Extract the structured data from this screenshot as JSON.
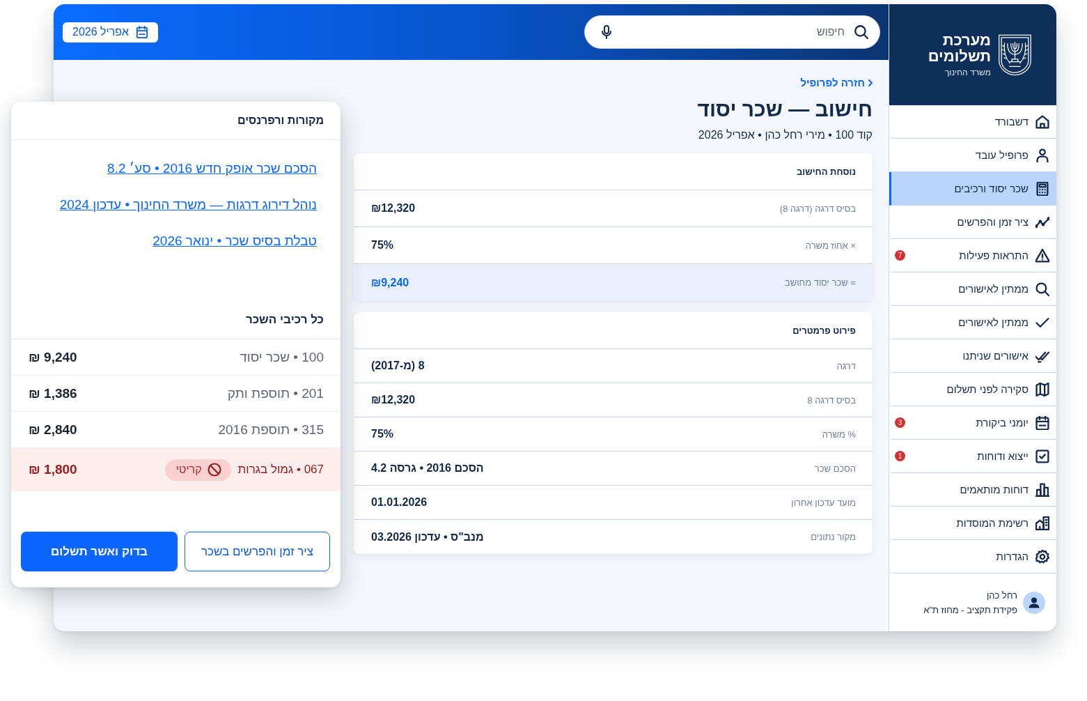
{
  "sidebar": {
    "title": "מערכת תשלומים",
    "subtitle": "משרד החינוך",
    "items": [
      {
        "label": "דשבורד",
        "selected": false
      },
      {
        "label": "פרופיל עובד",
        "selected": false
      },
      {
        "label": "שכר יסוד ורכיבים",
        "selected": true
      },
      {
        "label": "ציר זמן והפרשים",
        "selected": false
      },
      {
        "label": "התראות פעילות",
        "selected": false,
        "badge": "7"
      },
      {
        "label": "ממתין לאישורים",
        "selected": false
      },
      {
        "label": "ממתין לאישורים",
        "selected": false
      },
      {
        "label": "אישורים שניתנו",
        "selected": false
      },
      {
        "label": "סקירה לפני תשלום",
        "selected": false
      },
      {
        "label": "יומני ביקורת",
        "selected": false,
        "badge": "3"
      },
      {
        "label": "ייצוא ודוחות",
        "selected": false,
        "badge": "1"
      },
      {
        "label": "דוחות מותאמים",
        "selected": false
      },
      {
        "label": "רשימת המוסדות",
        "selected": false
      },
      {
        "label": "הגדרות",
        "selected": false
      }
    ],
    "user": {
      "name": "רחל כהן",
      "role": "פקידת תקציב - מחוז ת\"א"
    }
  },
  "top_bar": {
    "search": {
      "placeholder": "חיפוש"
    },
    "date_button": "אפריל 2026"
  },
  "page": {
    "back_link": "חזרה לפרופיל",
    "title": "חישוב — שכר יסוד",
    "subtitle": "קוד 100 • מירי רחל כהן • אפריל 2026"
  },
  "formula_card": {
    "title": "נוסחת החישוב",
    "rows": [
      {
        "label": "בסיס דרגה (דרגה 8)",
        "value": "₪12,320",
        "highlighted": false
      },
      {
        "label": "× אחוז משרה",
        "value": "75%",
        "highlighted": false
      },
      {
        "label": "= שכר יסוד מחושב",
        "value": "₪9,240",
        "highlighted": true
      }
    ]
  },
  "parameters_card": {
    "title": "פירוט פרמטרים",
    "rows": [
      {
        "label": "דרגה",
        "value": "8 (מ-2017)"
      },
      {
        "label": "בסיס דרגה 8",
        "value": "₪12,320"
      },
      {
        "label": "% משרה",
        "value": "75%"
      },
      {
        "label": "הסכם שכר",
        "value": "הסכם 2016 • גרסה 4.2"
      },
      {
        "label": "מועד עדכון אחרון",
        "value": "01.01.2026"
      },
      {
        "label": "מקור נתונים",
        "value": "מנב\"ס • עדכון 03.2026"
      }
    ]
  },
  "side_panel": {
    "sources_title": "מקורות ורפרנסים",
    "links": [
      "הסכם שכר אופק חדש 2016 • סע׳ 8.2",
      "נוהל דירוג דרגות — משרד החינוך • עדכון 2024",
      "טבלת בסיס שכר • ינואר 2026"
    ],
    "components_title": "כל רכיבי השכר",
    "components": [
      {
        "label": "100 • שכר יסוד",
        "amount": "₪ 9,240",
        "critical": false
      },
      {
        "label": "201 • תוספת ותק",
        "amount": "₪ 1,386",
        "critical": false
      },
      {
        "label": "315 • תוספת 2016",
        "amount": "₪ 2,840",
        "critical": false
      },
      {
        "label": "067 • גמול בגרות",
        "badge": "קריטי",
        "amount": "₪ 1,800",
        "critical": true
      }
    ],
    "buttons": [
      {
        "label": "ציר זמן והפרשים בשכר",
        "kind": "secondary"
      },
      {
        "label": "בדוק ואשר תשלום",
        "kind": "primary"
      }
    ]
  }
}
